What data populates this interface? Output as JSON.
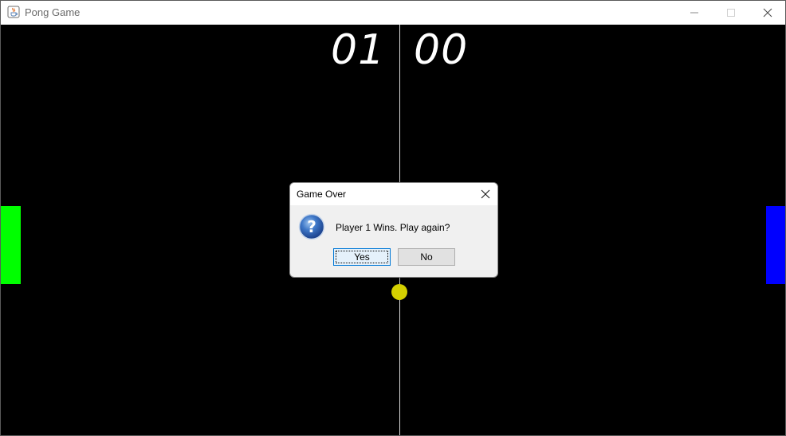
{
  "window": {
    "title": "Pong Game",
    "app_icon": "java-cup-icon"
  },
  "controls": {
    "minimize_icon": "minimize-icon",
    "maximize_icon": "maximize-icon",
    "close_icon": "close-icon"
  },
  "game": {
    "score_player1": "01",
    "score_player2": "00",
    "colors": {
      "background": "#000000",
      "paddle_left": "#00ff00",
      "paddle_right": "#0000ff",
      "ball": "#d4d000",
      "centerline": "#d8d8d8"
    }
  },
  "dialog": {
    "title": "Game Over",
    "message": "Player 1 Wins. Play again?",
    "icon": "question-icon",
    "yes_label": "Yes",
    "no_label": "No"
  }
}
